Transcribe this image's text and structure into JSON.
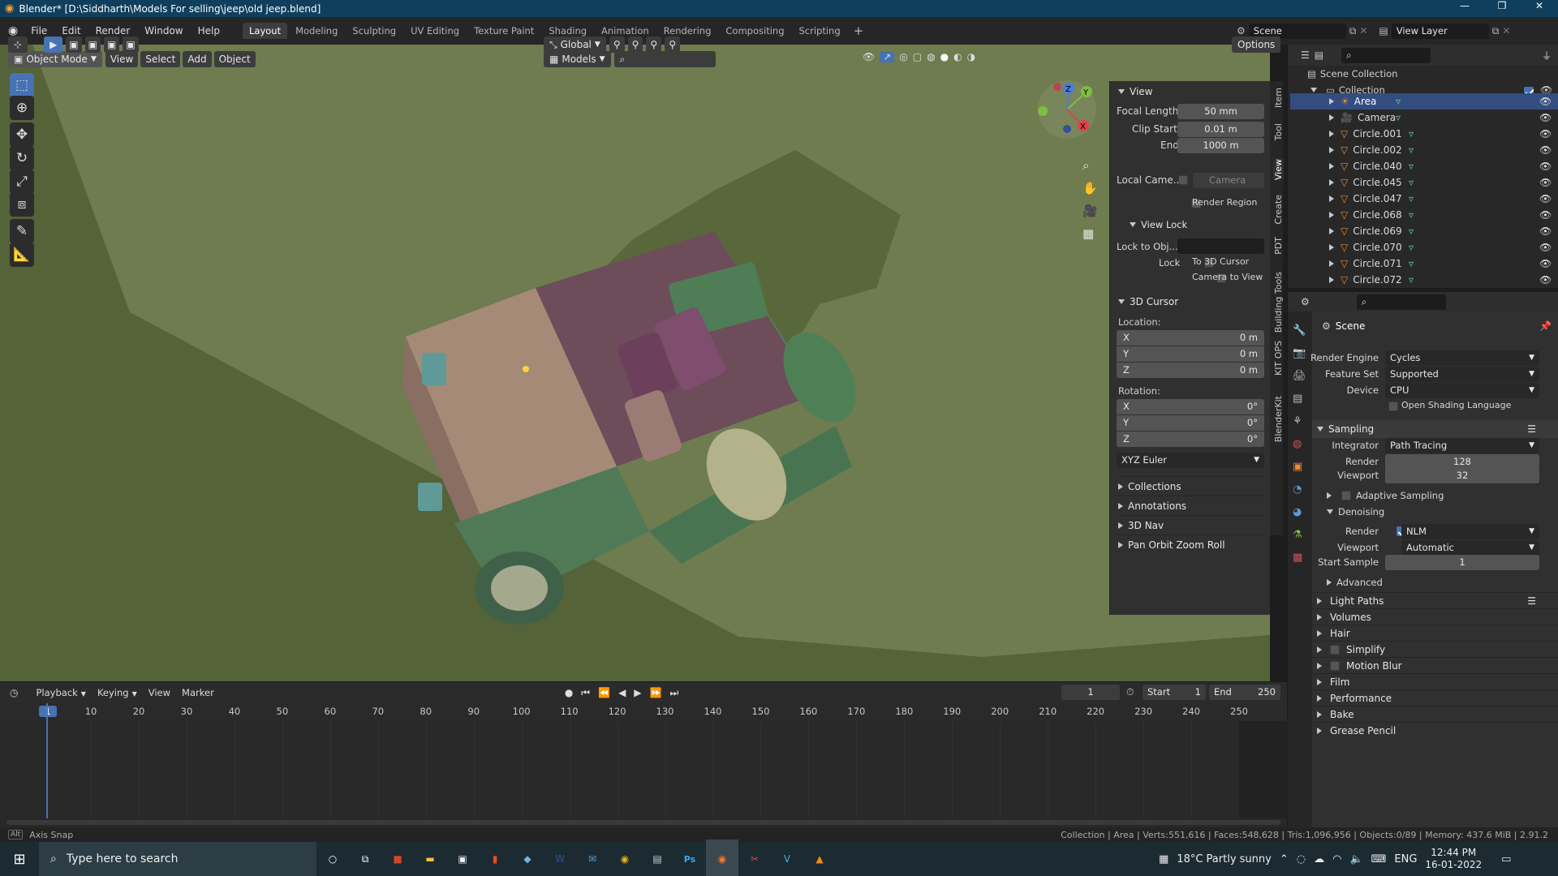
{
  "window": {
    "title": "Blender* [D:\\Siddharth\\Models For selling\\jeep\\old jeep.blend]"
  },
  "menu": [
    "File",
    "Edit",
    "Render",
    "Window",
    "Help"
  ],
  "workspaces": [
    "Layout",
    "Modeling",
    "Sculpting",
    "UV Editing",
    "Texture Paint",
    "Shading",
    "Animation",
    "Rendering",
    "Compositing",
    "Scripting"
  ],
  "topbar": {
    "scene": "Scene",
    "view_layer": "View Layer"
  },
  "header": {
    "mode": "Object Mode",
    "menus": [
      "View",
      "Select",
      "Add",
      "Object"
    ],
    "orientation": "Global",
    "collection_filter": "Models",
    "options": "Options"
  },
  "npanel": {
    "view_header": "View",
    "focal_length_label": "Focal Length",
    "focal_length": "50 mm",
    "clip_start_label": "Clip Start",
    "clip_start": "0.01 m",
    "clip_end_label": "End",
    "clip_end": "1000 m",
    "local_camera_label": "Local Came...",
    "local_camera": "Camera",
    "render_region": "Render Region",
    "view_lock_header": "View Lock",
    "lock_to_obj_label": "Lock to Obj...",
    "lock_label": "Lock",
    "to_3d_cursor": "To 3D Cursor",
    "camera_to_view": "Camera to View",
    "cursor_header": "3D Cursor",
    "location_label": "Location:",
    "rotation_label": "Rotation:",
    "loc": [
      {
        "axis": "X",
        "value": "0 m"
      },
      {
        "axis": "Y",
        "value": "0 m"
      },
      {
        "axis": "Z",
        "value": "0 m"
      }
    ],
    "rot": [
      {
        "axis": "X",
        "value": "0°"
      },
      {
        "axis": "Y",
        "value": "0°"
      },
      {
        "axis": "Z",
        "value": "0°"
      }
    ],
    "rot_mode": "XYZ Euler",
    "collapsed": [
      "Collections",
      "Annotations",
      "3D Nav",
      "Pan Orbit Zoom Roll"
    ],
    "tabs": [
      "Item",
      "Tool",
      "View",
      "Create",
      "PDT",
      "Building Tools",
      "KIT OPS",
      "BlenderKit"
    ]
  },
  "outliner": {
    "scene_collection": "Scene Collection",
    "collection": "Collection",
    "items": [
      "Area",
      "Camera",
      "Circle.001",
      "Circle.002",
      "Circle.040",
      "Circle.045",
      "Circle.047",
      "Circle.068",
      "Circle.069",
      "Circle.070",
      "Circle.071",
      "Circle.072"
    ]
  },
  "properties": {
    "scene": "Scene",
    "render_engine_label": "Render Engine",
    "render_engine": "Cycles",
    "feature_set_label": "Feature Set",
    "feature_set": "Supported",
    "device_label": "Device",
    "device": "CPU",
    "osl": "Open Shading Language",
    "sampling": "Sampling",
    "integrator_label": "Integrator",
    "integrator": "Path Tracing",
    "render_label": "Render",
    "render_samples": "128",
    "viewport_label": "Viewport",
    "viewport_samples": "32",
    "adaptive": "Adaptive Sampling",
    "denoising": "Denoising",
    "den_render_label": "Render",
    "den_render": "NLM",
    "den_viewport_label": "Viewport",
    "den_viewport": "Automatic",
    "start_sample_label": "Start Sample",
    "start_sample": "1",
    "advanced": "Advanced",
    "sections": [
      "Light Paths",
      "Volumes",
      "Hair",
      "Simplify",
      "Motion Blur",
      "Film",
      "Performance",
      "Bake",
      "Grease Pencil"
    ]
  },
  "timeline": {
    "menus": [
      "Playback",
      "Keying",
      "View",
      "Marker"
    ],
    "current_frame": "1",
    "start_label": "Start",
    "start": "1",
    "end_label": "End",
    "end": "250",
    "ticks": [
      "1",
      "10",
      "20",
      "30",
      "40",
      "50",
      "60",
      "70",
      "80",
      "90",
      "100",
      "110",
      "120",
      "130",
      "140",
      "150",
      "160",
      "170",
      "180",
      "190",
      "200",
      "210",
      "220",
      "230",
      "240",
      "250"
    ]
  },
  "status": {
    "left": "Axis Snap",
    "right": "Collection | Area | Verts:551,616 | Faces:548,628 | Tris:1,096,956 | Objects:0/89 | Memory: 437.6 MiB | 2.91.2"
  },
  "taskbar": {
    "search": "Type here to search",
    "weather": "18°C  Partly sunny",
    "lang": "ENG",
    "time": "12:44 PM",
    "date": "16-01-2022"
  },
  "colors": {
    "accent": "#4772b3",
    "viewport_bg": "#6f7d4e",
    "titlebar": "#0f3f5c"
  }
}
